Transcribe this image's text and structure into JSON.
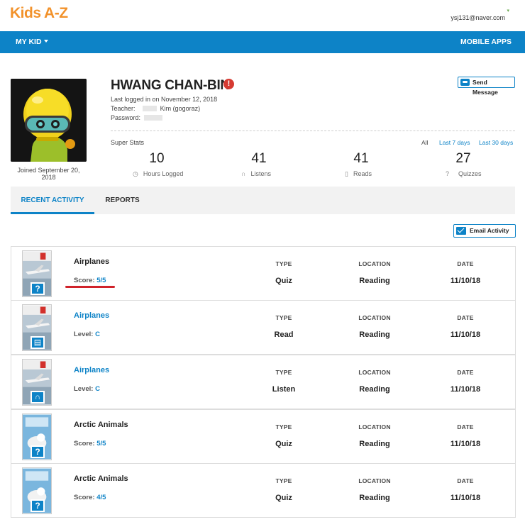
{
  "header": {
    "logo": "Kids A-Z",
    "user_email": "ysj131@naver.com"
  },
  "nav": {
    "my_kid": "MY KID",
    "mobile_apps": "MOBILE APPS"
  },
  "profile": {
    "name": "HWANG CHAN-BIN",
    "alert": "!",
    "last_logged": "Last logged in on November 12, 2018",
    "teacher_label": "Teacher:",
    "teacher_value": "Kim (gogoraz)",
    "password_label": "Password:",
    "joined": "Joined September 20, 2018",
    "send_message": "Send Message"
  },
  "stats": {
    "label": "Super Stats",
    "periods": [
      "All",
      "Last 7 days",
      "Last 30 days"
    ],
    "items": [
      {
        "value": "10",
        "label": "Hours Logged",
        "icon": "clock-icon"
      },
      {
        "value": "41",
        "label": "Listens",
        "icon": "headphones-icon"
      },
      {
        "value": "41",
        "label": "Reads",
        "icon": "book-icon"
      },
      {
        "value": "27",
        "label": "Quizzes",
        "icon": "question-icon"
      }
    ]
  },
  "tabs": {
    "recent": "RECENT ACTIVITY",
    "reports": "REPORTS"
  },
  "email_activity": "Email Activity",
  "columns": {
    "type": "TYPE",
    "location": "LOCATION",
    "date": "DATE"
  },
  "activities": [
    {
      "title": "Airplanes",
      "sub_label": "Score:",
      "sub_value": "5/5",
      "type": "Quiz",
      "location": "Reading",
      "date": "11/10/18",
      "badge": "?",
      "cover": "airplane",
      "link": false
    },
    {
      "title": "Airplanes",
      "sub_label": "Level:",
      "sub_value": "C",
      "type": "Read",
      "location": "Reading",
      "date": "11/10/18",
      "badge": "book",
      "cover": "airplane",
      "link": true
    },
    {
      "title": "Airplanes",
      "sub_label": "Level:",
      "sub_value": "C",
      "type": "Listen",
      "location": "Reading",
      "date": "11/10/18",
      "badge": "headphones",
      "cover": "airplane",
      "link": true
    },
    {
      "title": "Arctic Animals",
      "sub_label": "Score:",
      "sub_value": "5/5",
      "type": "Quiz",
      "location": "Reading",
      "date": "11/10/18",
      "badge": "?",
      "cover": "arctic",
      "link": false
    },
    {
      "title": "Arctic Animals",
      "sub_label": "Score:",
      "sub_value": "4/5",
      "type": "Quiz",
      "location": "Reading",
      "date": "11/10/18",
      "badge": "?",
      "cover": "arctic",
      "link": false
    }
  ],
  "colors": {
    "brand_orange": "#f2922b",
    "nav_blue": "#0d83c7",
    "alert_red": "#d63a32"
  }
}
